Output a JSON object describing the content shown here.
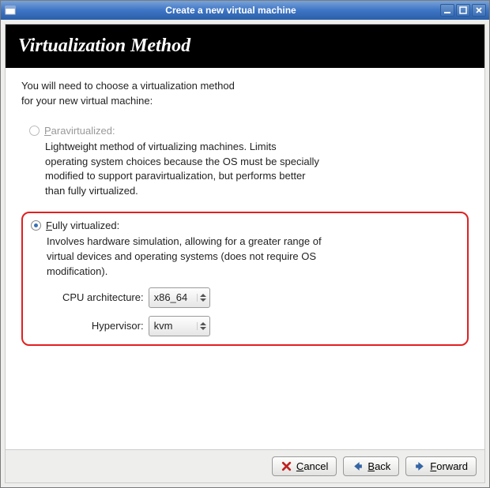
{
  "window": {
    "title": "Create a new virtual machine"
  },
  "page": {
    "heading": "Virtualization Method",
    "intro_line1": "You will need to choose a virtualization method",
    "intro_line2": "for your new virtual machine:"
  },
  "options": {
    "para": {
      "label_u": "P",
      "label_rest": "aravirtualized:",
      "desc": "Lightweight method of virtualizing machines. Limits operating system choices because the OS must be specially modified to support paravirtualization, but performs better than fully virtualized."
    },
    "full": {
      "label_u": "F",
      "label_rest": "ully virtualized:",
      "desc": "Involves hardware simulation, allowing for a greater range of virtual devices and operating systems (does not require OS modification).",
      "fields": {
        "cpu_label": "CPU architecture:",
        "cpu_value": "x86_64",
        "hyp_label": "Hypervisor:",
        "hyp_value": "kvm"
      }
    }
  },
  "buttons": {
    "cancel_u": "C",
    "cancel_rest": "ancel",
    "back_u": "B",
    "back_rest": "ack",
    "forward_u": "F",
    "forward_rest": "orward"
  }
}
